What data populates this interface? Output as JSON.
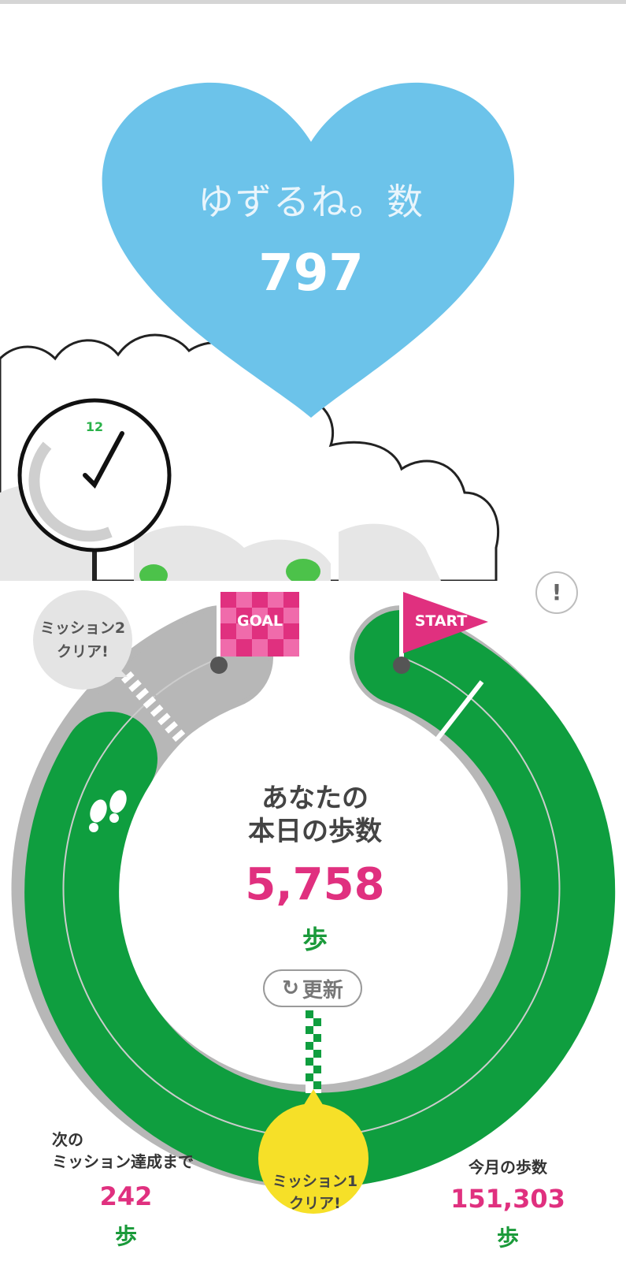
{
  "banner": {
    "heart_title": "ゆずるね。数",
    "heart_count": "797",
    "clock_label": "12"
  },
  "tracker": {
    "center_label_line1": "あなたの",
    "center_label_line2": "本日の歩数",
    "steps_today": "5,758",
    "steps_unit": "歩",
    "refresh_label": "更新",
    "refresh_icon": "refresh-icon",
    "info_label": "!",
    "goal_flag": "GOAL",
    "start_flag": "START",
    "mission2_line1": "ミッション2",
    "mission2_line2": "クリア!",
    "mission1_line1": "ミッション1",
    "mission1_line2": "クリア!",
    "next_mission_line1": "次の",
    "next_mission_line2": "ミッション達成まで",
    "next_mission_value": "242",
    "next_mission_unit": "歩",
    "month_label": "今月の歩数",
    "month_value": "151,303",
    "month_unit": "歩"
  },
  "colors": {
    "heart": "#6cc3ea",
    "track_green": "#0f9e3f",
    "track_gray": "#b7b7b7",
    "accent_pink": "#e0307f",
    "mission_yellow": "#f6e028",
    "unit_green": "#1a9a3a"
  }
}
